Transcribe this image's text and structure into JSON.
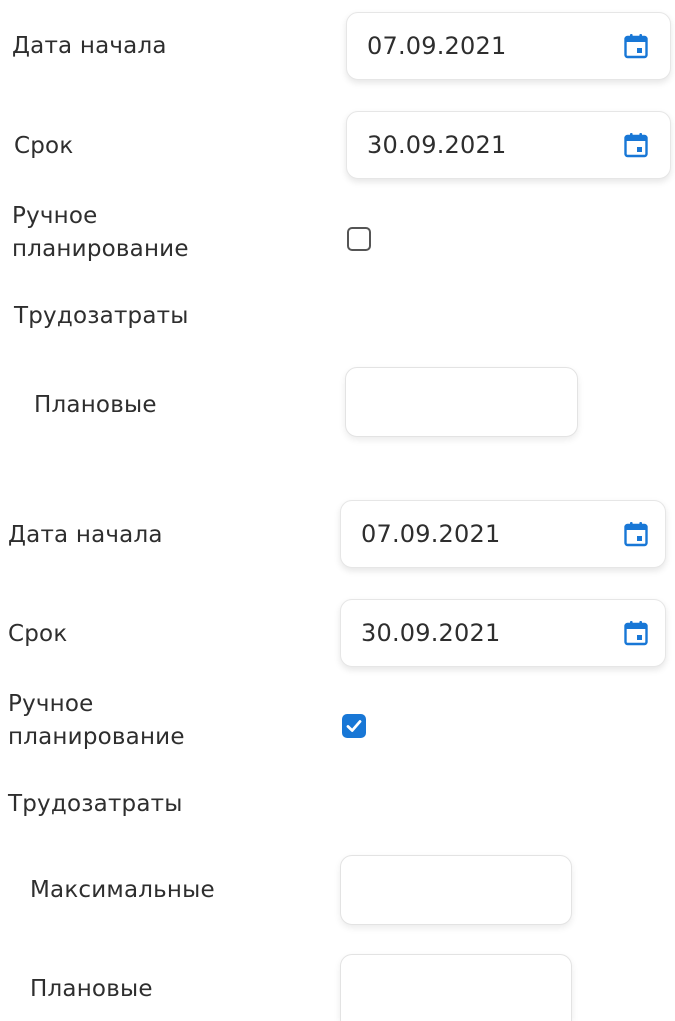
{
  "colors": {
    "accent": "#1877d6",
    "text": "#2e2e2e",
    "border": "#e6e6e6"
  },
  "form_before": {
    "start_date_label": "Дата начала",
    "start_date_value": "07.09.2021",
    "deadline_label": "Срок",
    "deadline_value": "30.09.2021",
    "manual_planning_label_line1": "Ручное",
    "manual_planning_label_line2": "планирование",
    "manual_planning_checked": false,
    "labor_costs_label": "Трудозатраты",
    "planned_label": "Плановые",
    "planned_value": ""
  },
  "form_after": {
    "start_date_label": "Дата начала",
    "start_date_value": "07.09.2021",
    "deadline_label": "Срок",
    "deadline_value": "30.09.2021",
    "manual_planning_label_line1": "Ручное",
    "manual_planning_label_line2": "планирование",
    "manual_planning_checked": true,
    "labor_costs_label": "Трудозатраты",
    "maximum_label": "Максимальные",
    "maximum_value": "",
    "planned_label": "Плановые",
    "planned_value": ""
  },
  "icons": {
    "calendar": "calendar-icon",
    "check": "checkmark-icon"
  }
}
